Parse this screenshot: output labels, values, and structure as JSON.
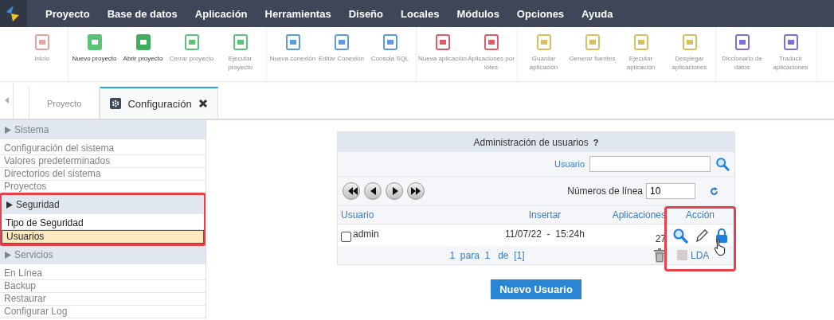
{
  "menu": {
    "items": [
      "Proyecto",
      "Base de datos",
      "Aplicación",
      "Herramientas",
      "Diseño",
      "Locales",
      "Módulos",
      "Opciones",
      "Ayuda"
    ]
  },
  "toolbar": {
    "groups": [
      [
        {
          "label": "Inicio",
          "disabled": true,
          "color": "#e8a0a0"
        }
      ],
      [
        {
          "label": "Nuevo proyecto",
          "disabled": false,
          "color": "#5cc27a"
        },
        {
          "label": "Abrir proyecto",
          "disabled": false,
          "color": "#3fae5f"
        },
        {
          "label": "Cerrar proyecto",
          "disabled": true,
          "color": "#5cc27a"
        },
        {
          "label": "Ejecutar proyecto",
          "disabled": true,
          "color": "#5cc27a"
        }
      ],
      [
        {
          "label": "Nueva conexión",
          "disabled": true,
          "color": "#5b9be0"
        },
        {
          "label": "Editar Conexión",
          "disabled": true,
          "color": "#5b9be0"
        },
        {
          "label": "Consola SQL",
          "disabled": true,
          "color": "#5b9be0"
        }
      ],
      [
        {
          "label": "Nueva aplicación",
          "disabled": true,
          "color": "#e05b6a"
        },
        {
          "label": "Aplicaciones por lotes",
          "disabled": true,
          "color": "#e05b6a"
        }
      ],
      [
        {
          "label": "Guardar aplicación",
          "disabled": true,
          "color": "#d8c060"
        },
        {
          "label": "Generar fuentes",
          "disabled": true,
          "color": "#d8c060"
        },
        {
          "label": "Ejecutar aplicación",
          "disabled": true,
          "color": "#d8c060"
        },
        {
          "label": "Desplegar aplicaciones",
          "disabled": true,
          "color": "#d8c060"
        }
      ],
      [
        {
          "label": "Diccionario de datos",
          "disabled": true,
          "color": "#7a6fe0"
        },
        {
          "label": "Traducir aplicaciones",
          "disabled": true,
          "color": "#7a6fe0"
        }
      ]
    ]
  },
  "tabs": [
    {
      "label": "Proyecto",
      "selected": false,
      "dimmed": true,
      "kind": "plain",
      "closable": false
    },
    {
      "label": "Configuración",
      "selected": true,
      "dimmed": false,
      "kind": "settings",
      "closable": true
    }
  ],
  "sidebar": {
    "sections": [
      {
        "title": "Sistema",
        "dimmed": true,
        "highlighted": false,
        "items": [
          {
            "label": "Configuración del sistema",
            "selected": false
          },
          {
            "label": "Valores predeterminados",
            "selected": false
          },
          {
            "label": "Directorios del sistema",
            "selected": false
          },
          {
            "label": "Proyectos",
            "selected": false
          }
        ]
      },
      {
        "title": "Seguridad",
        "dimmed": false,
        "highlighted": true,
        "items": [
          {
            "label": "Tipo de Seguridad",
            "selected": false
          },
          {
            "label": "Usuarios",
            "selected": true
          }
        ]
      },
      {
        "title": "Servicios",
        "dimmed": true,
        "highlighted": false,
        "items": [
          {
            "label": "En Línea",
            "selected": false
          },
          {
            "label": "Backup",
            "selected": false
          },
          {
            "label": "Restaurar",
            "selected": false
          },
          {
            "label": "Configurar Log",
            "selected": false
          }
        ]
      }
    ]
  },
  "user_admin": {
    "title": "Administración de usuarios",
    "help": "?",
    "search": {
      "label": "Usuario"
    },
    "lines": {
      "label": "Números de línea",
      "value": "10"
    },
    "columns": [
      "Usuario",
      "Insertar",
      "Aplicaciones",
      "Acción"
    ],
    "rows": [
      {
        "user": "admin",
        "checked": false,
        "inserted": "11/07/22  -  15:24h",
        "apps": "27"
      }
    ],
    "pager": "1  para  1   de  [1]",
    "ldap": "LDA",
    "action_highlighted": true
  },
  "new_button": "Nuevo Usuario"
}
